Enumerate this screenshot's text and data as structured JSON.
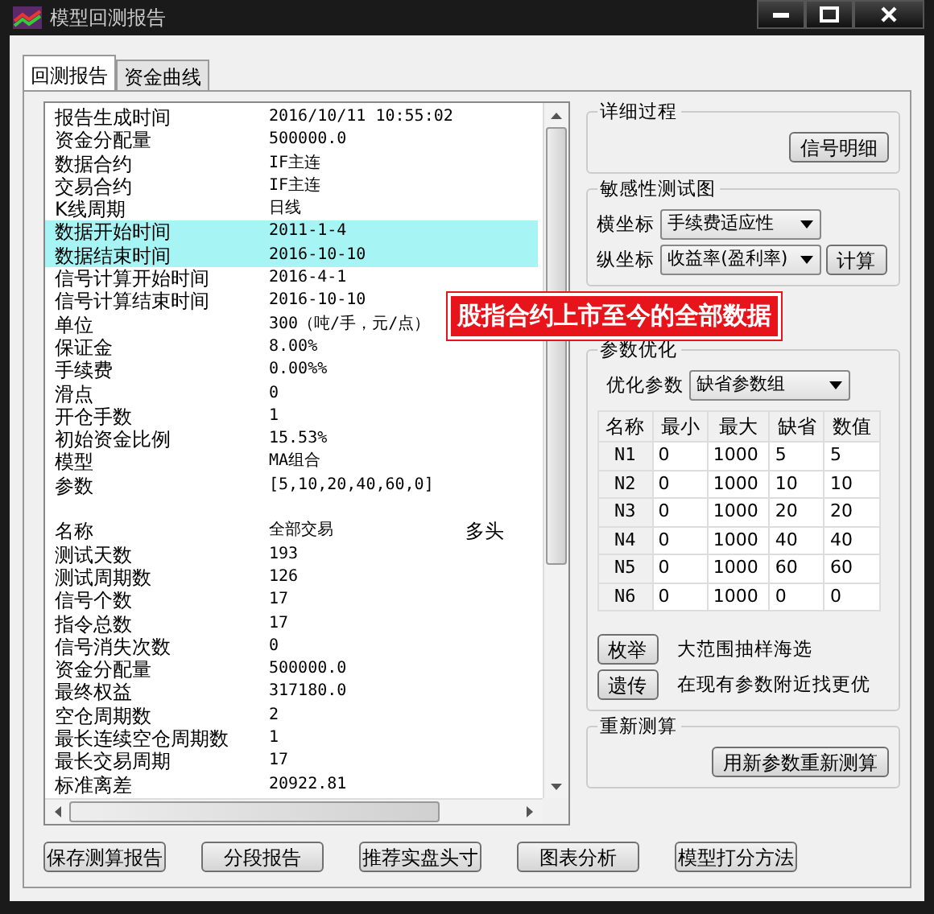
{
  "window": {
    "title": "模型回测报告"
  },
  "tabs": [
    {
      "label": "回测报告",
      "selected": true
    },
    {
      "label": "资金曲线",
      "selected": false
    }
  ],
  "report": {
    "sections": [
      {
        "rows": [
          {
            "label": "报告生成时间",
            "value": "2016/10/11 10:55:02",
            "highlighted": false
          },
          {
            "label": "资金分配量",
            "value": "500000.0",
            "highlighted": false
          },
          {
            "label": "数据合约",
            "value": "IF主连",
            "highlighted": false
          },
          {
            "label": "交易合约",
            "value": "IF主连",
            "highlighted": false
          },
          {
            "label": "K线周期",
            "value": "日线",
            "highlighted": false
          },
          {
            "label": "数据开始时间",
            "value": "2011-1-4",
            "highlighted": true
          },
          {
            "label": "数据结束时间",
            "value": "2016-10-10",
            "highlighted": true
          },
          {
            "label": "信号计算开始时间",
            "value": "2016-4-1",
            "highlighted": false
          },
          {
            "label": "信号计算结束时间",
            "value": "2016-10-10",
            "highlighted": false
          },
          {
            "label": "单位",
            "value": "300（吨/手，元/点）",
            "highlighted": false
          },
          {
            "label": "保证金",
            "value": "8.00%",
            "highlighted": false
          },
          {
            "label": "手续费",
            "value": "0.00%%",
            "highlighted": false
          },
          {
            "label": "滑点",
            "value": "0",
            "highlighted": false
          },
          {
            "label": "开仓手数",
            "value": "1",
            "highlighted": false
          },
          {
            "label": "初始资金比例",
            "value": "15.53%",
            "highlighted": false
          },
          {
            "label": "模型",
            "value": "MA组合",
            "highlighted": false
          },
          {
            "label": "参数",
            "value": "[5,10,20,40,60,0]",
            "highlighted": false
          }
        ]
      },
      {
        "rows": [
          {
            "label": "名称",
            "value": "全部交易",
            "value_2": "多头",
            "highlighted": false
          },
          {
            "label": "测试天数",
            "value": "193",
            "highlighted": false
          },
          {
            "label": "测试周期数",
            "value": "126",
            "highlighted": false
          },
          {
            "label": "信号个数",
            "value": "17",
            "highlighted": false
          },
          {
            "label": "指令总数",
            "value": "17",
            "highlighted": false
          },
          {
            "label": "信号消失次数",
            "value": "0",
            "highlighted": false
          },
          {
            "label": "资金分配量",
            "value": "500000.0",
            "highlighted": false
          },
          {
            "label": "最终权益",
            "value": "317180.0",
            "highlighted": false
          },
          {
            "label": "空仓周期数",
            "value": "2",
            "highlighted": false
          },
          {
            "label": "最长连续空仓周期数",
            "value": "1",
            "highlighted": false
          },
          {
            "label": "最长交易周期",
            "value": "17",
            "highlighted": false
          },
          {
            "label": "标准离差",
            "value": "20922.81",
            "highlighted": false
          }
        ]
      }
    ]
  },
  "annotation": "股指合约上市至今的全部数据",
  "detail": {
    "title": "详细过程",
    "button": "信号明细"
  },
  "sensitivity": {
    "title": "敏感性测试图",
    "x_label": "横坐标",
    "x_value": "手续费适应性",
    "y_label": "纵坐标",
    "y_value": "收益率(盈利率)",
    "button": "计算"
  },
  "optimization": {
    "title": "参数优化",
    "param_label": "优化参数",
    "param_value": "缺省参数组",
    "columns": [
      "名称",
      "最小",
      "最大",
      "缺省",
      "数值"
    ],
    "rows": [
      [
        "N1",
        "0",
        "1000",
        "5",
        "5"
      ],
      [
        "N2",
        "0",
        "1000",
        "10",
        "10"
      ],
      [
        "N3",
        "0",
        "1000",
        "20",
        "20"
      ],
      [
        "N4",
        "0",
        "1000",
        "40",
        "40"
      ],
      [
        "N5",
        "0",
        "1000",
        "60",
        "60"
      ],
      [
        "N6",
        "0",
        "1000",
        "0",
        "0"
      ]
    ],
    "methods": [
      {
        "button": "枚举",
        "description": "大范围抽样海选"
      },
      {
        "button": "遗传",
        "description": "在现有参数附近找更优"
      }
    ]
  },
  "recalc": {
    "title": "重新测算",
    "button": "用新参数重新测算"
  },
  "buttons": [
    "保存测算报告",
    "分段报告",
    "推荐实盘头寸",
    "图表分析",
    "模型打分方法"
  ]
}
